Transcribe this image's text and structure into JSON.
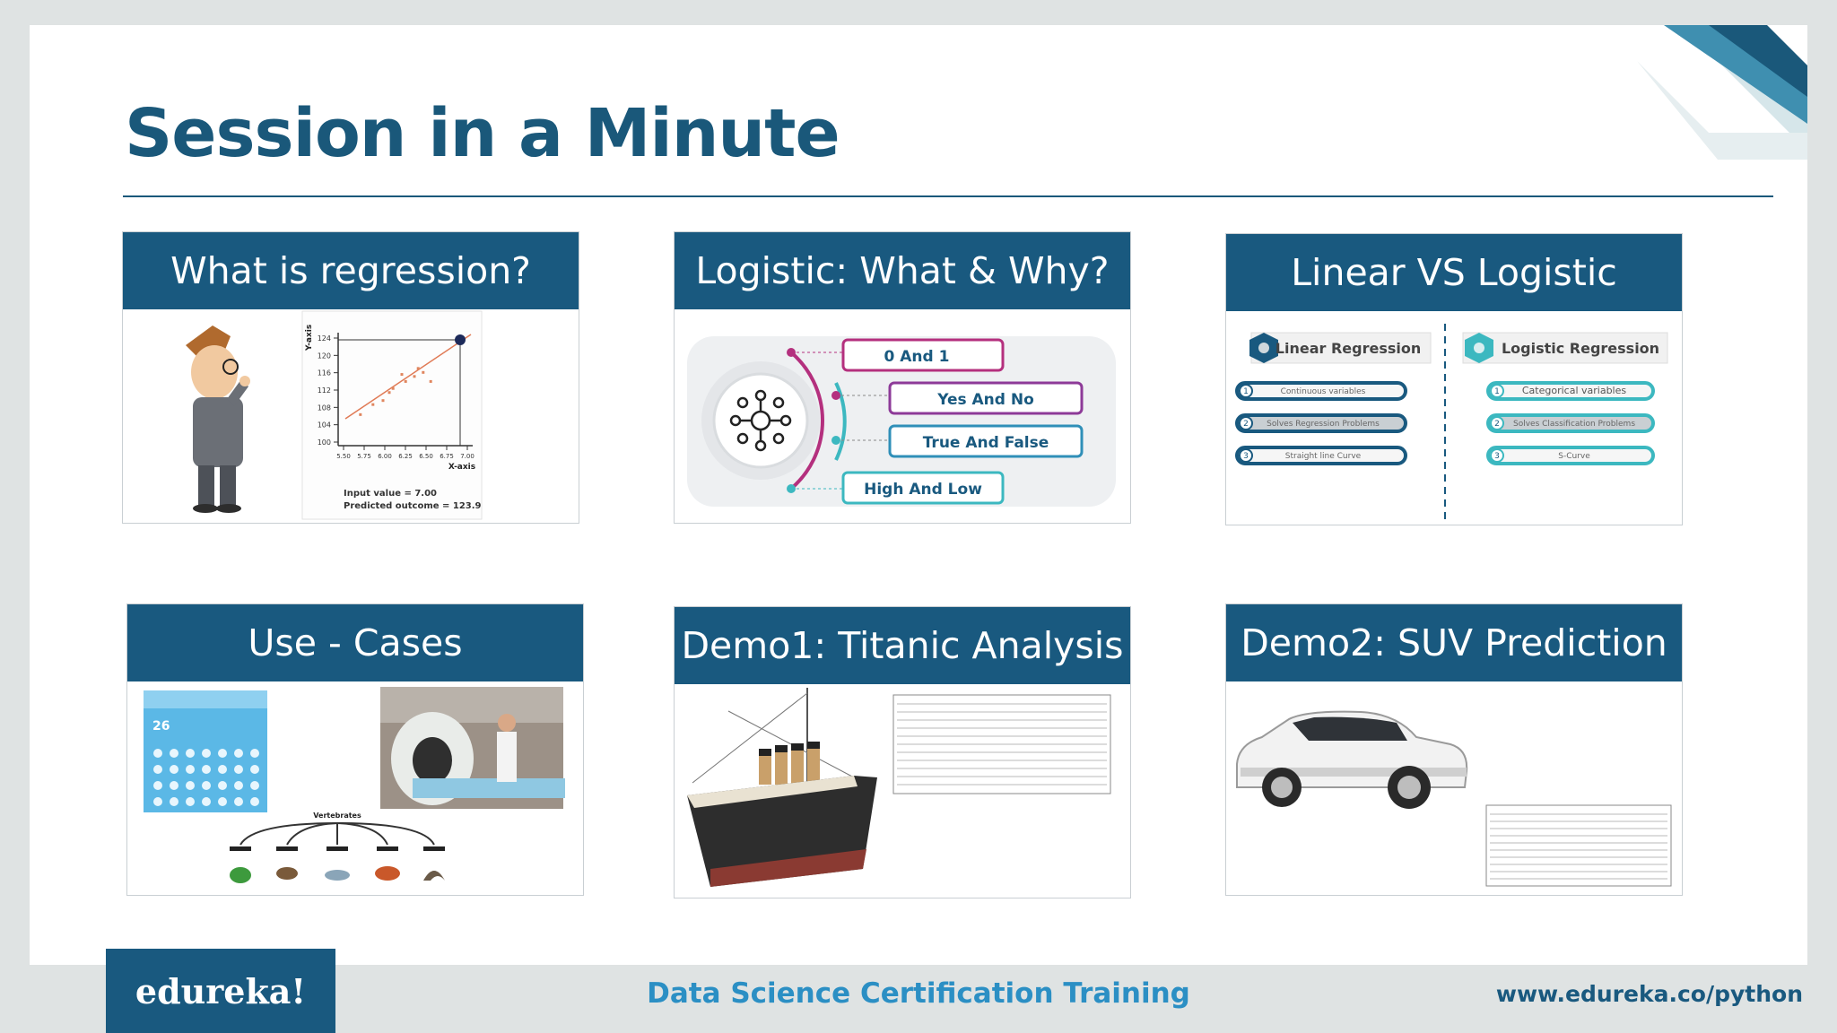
{
  "slide": {
    "title": "Session in a Minute",
    "footer": {
      "logo": "edureka!",
      "course": "Data Science Certification Training",
      "url": "www.edureka.co/python"
    }
  },
  "cards": [
    {
      "title": "What is regression?",
      "chart": {
        "yaxis_label": "Y-axis",
        "xaxis_label": "X-axis",
        "y_ticks": [
          "100",
          "104",
          "108",
          "112",
          "116",
          "120",
          "124"
        ],
        "x_ticks": [
          "5.50",
          "5.75",
          "6.00",
          "6.25",
          "6.50",
          "6.75",
          "7.00"
        ],
        "input_text": "Input value = 7.00",
        "output_text": "Predicted outcome = 123.9"
      }
    },
    {
      "title": "Logistic: What & Why?",
      "options": [
        "0 And 1",
        "Yes And No",
        "True And False",
        "High And Low"
      ]
    },
    {
      "title": "Linear VS Logistic",
      "left": {
        "heading": "Linear Regression",
        "items": [
          "Continuous variables",
          "Solves Regression Problems",
          "Straight line Curve"
        ]
      },
      "right": {
        "heading": "Logistic Regression",
        "items": [
          "Categorical variables",
          "Solves Classification Problems",
          "S-Curve"
        ]
      }
    },
    {
      "title": "Use - Cases",
      "tree_label": "Vertebrates",
      "weather_temp": "26"
    },
    {
      "title": "Demo1: Titanic Analysis"
    },
    {
      "title": "Demo2: SUV Prediction"
    }
  ],
  "colors": {
    "brand": "#19597f",
    "accent": "#2b8fc4",
    "teal": "#3cb8c0",
    "magenta": "#b4307e"
  }
}
